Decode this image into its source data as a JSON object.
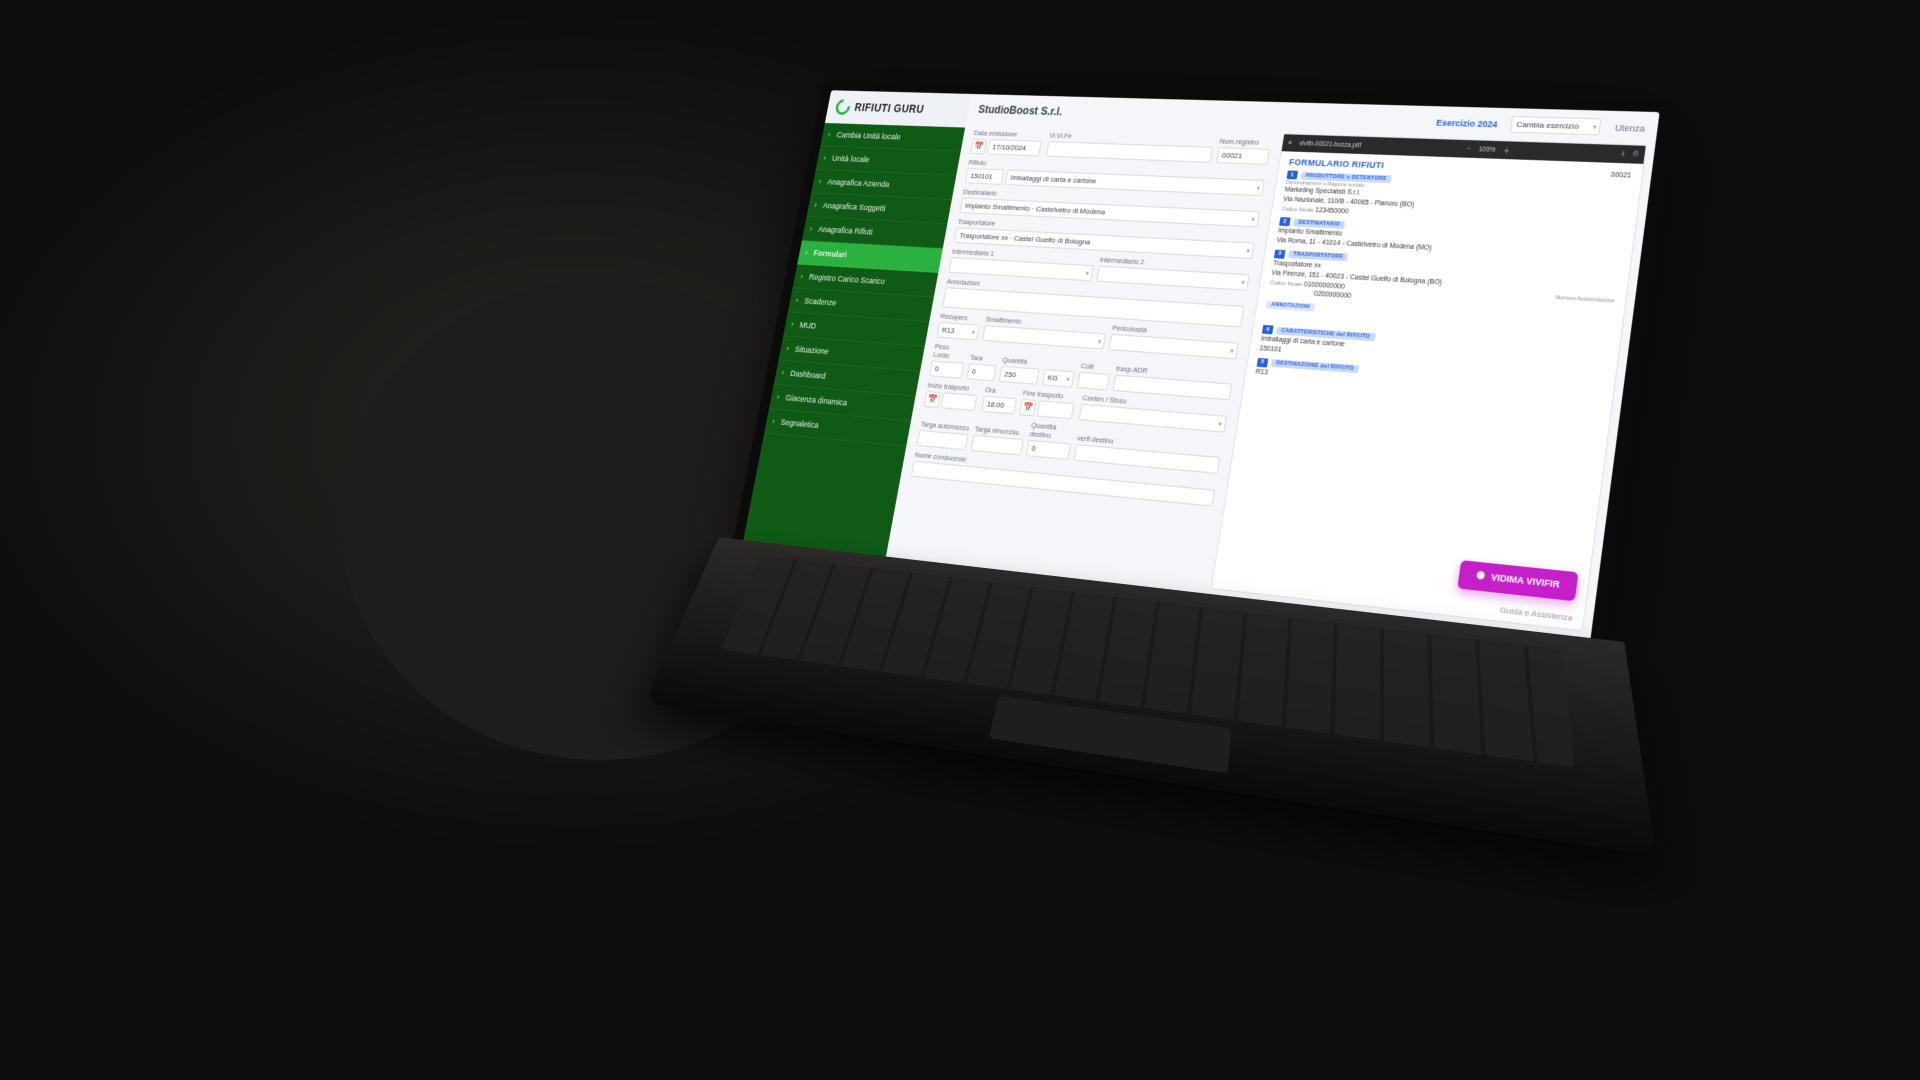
{
  "brand": "RIFIUTI GURU",
  "sidebar": {
    "items": [
      "Cambia Unità locale",
      "Unità locale",
      "Anagrafica Azienda",
      "Anagrafica Soggetti",
      "Anagrafica Rifiuti",
      "Formulari",
      "Registro Carico Scarico",
      "Scadenze",
      "MUD",
      "Situazione",
      "Dashboard",
      "Giacenza dinamica",
      "Segnaletica"
    ],
    "active_index": 5
  },
  "topbar": {
    "company": "StudioBoost S.r.l.",
    "esercizio": "Esercizio 2024",
    "cambia": "Cambia esercizio",
    "utenza": "Utenza"
  },
  "form": {
    "data_emissione_lbl": "Data emissione",
    "data_emissione": "17/10/2024",
    "vivifir_lbl": "Vi.Vi.Fir",
    "vivifir": "",
    "num_registro_lbl": "Num.registro",
    "num_registro": "00021",
    "rifiuto_lbl": "Rifiuto",
    "rifiuto_code": "150101",
    "rifiuto_desc": "Imballaggi di carta e cartone",
    "destinatario_lbl": "Destinatario",
    "destinatario": "Impianto Smaltimento · Castelvetro di Modena",
    "trasportatore_lbl": "Trasportatore",
    "trasportatore": "Trasportatore xx · Castel Guelfo di Bologna",
    "inter1_lbl": "Intermediario 1",
    "inter2_lbl": "Intermediario 2",
    "annotazioni_lbl": "Annotazioni",
    "recupero_lbl": "Recupero",
    "recupero": "R13",
    "smaltimento_lbl": "Smaltimento",
    "pericolosita_lbl": "Pericolosità",
    "peso_lordo_lbl": "Peso Lordo",
    "peso_lordo": "0",
    "tara_lbl": "Tara",
    "tara": "0",
    "quantita_lbl": "Quantità",
    "quantita": "250",
    "unita": "KG",
    "colli_lbl": "Colli",
    "trasp_adr_lbl": "trasp.ADR",
    "inizio_trasporto_lbl": "Inizio trasporto",
    "ora_lbl": "Ora",
    "ora": "18:00",
    "fine_trasporto_lbl": "Fine trasporto",
    "conten_sfuso_lbl": "Conten / Sfuso",
    "targa_automezzo_lbl": "Targa automezzo",
    "targa_rimorchio_lbl": "Targa rimorchio",
    "quantita_dest_lbl": "Quantità destino",
    "quantita_dest": "0",
    "verif_dest_lbl": "verif.destino",
    "nome_conducente_lbl": "Nome conducente"
  },
  "pdf": {
    "file": "vivifir-00021-bozza.pdf",
    "zoom": "100%",
    "title": "FORMULARIO RIFIUTI",
    "num": "00021",
    "s1_tag": "PRODUTTORE o DETENTORE",
    "s1_l1": "Marketing Specialisti S.r.l.",
    "s1_l2": "Via Nazionale, 110/B - 40065 - Pianoro  (BO)",
    "s1_l3": "123450000",
    "s2_tag": "DESTINATARIO",
    "s2_l1": "Impianto Smaltimento",
    "s2_l2": "Via Roma, 11 - 41014 - Castelvetro di Modena  (MO)",
    "s3_tag": "TRASPORTATORE",
    "s3_l1": "Trasportatore xx",
    "s3_l2": "Via Firenze, 151 - 40023 - Castel Guelfo di Bologna  (BO)",
    "s3_cf_lbl": "Codice fiscale",
    "s3_cf": "01000000000",
    "s3_aut": "0200000000",
    "s3_aut_lbl": "Numero Autorizzazione",
    "annot_tag": "ANNOTAZIONI",
    "s4_tag": "CARATTERISTICHE del RIFIUTO",
    "s4_l1": "Imballaggi di carta e cartone",
    "s4_code": "150101",
    "s5_tag": "DESTINAZIONE del RIFIUTO",
    "s5_rec": "R13"
  },
  "cta": "VIDIMA VIVIFIR",
  "help": "Guida e Assistenza"
}
